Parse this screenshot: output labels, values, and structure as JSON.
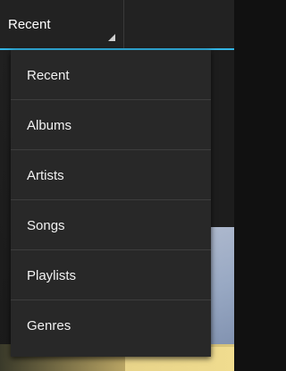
{
  "action_bar": {
    "current_view": "Recent",
    "accent_color": "#33b5e5"
  },
  "menu": {
    "items": [
      {
        "label": "Recent"
      },
      {
        "label": "Albums"
      },
      {
        "label": "Artists"
      },
      {
        "label": "Songs"
      },
      {
        "label": "Playlists"
      },
      {
        "label": "Genres"
      }
    ]
  }
}
